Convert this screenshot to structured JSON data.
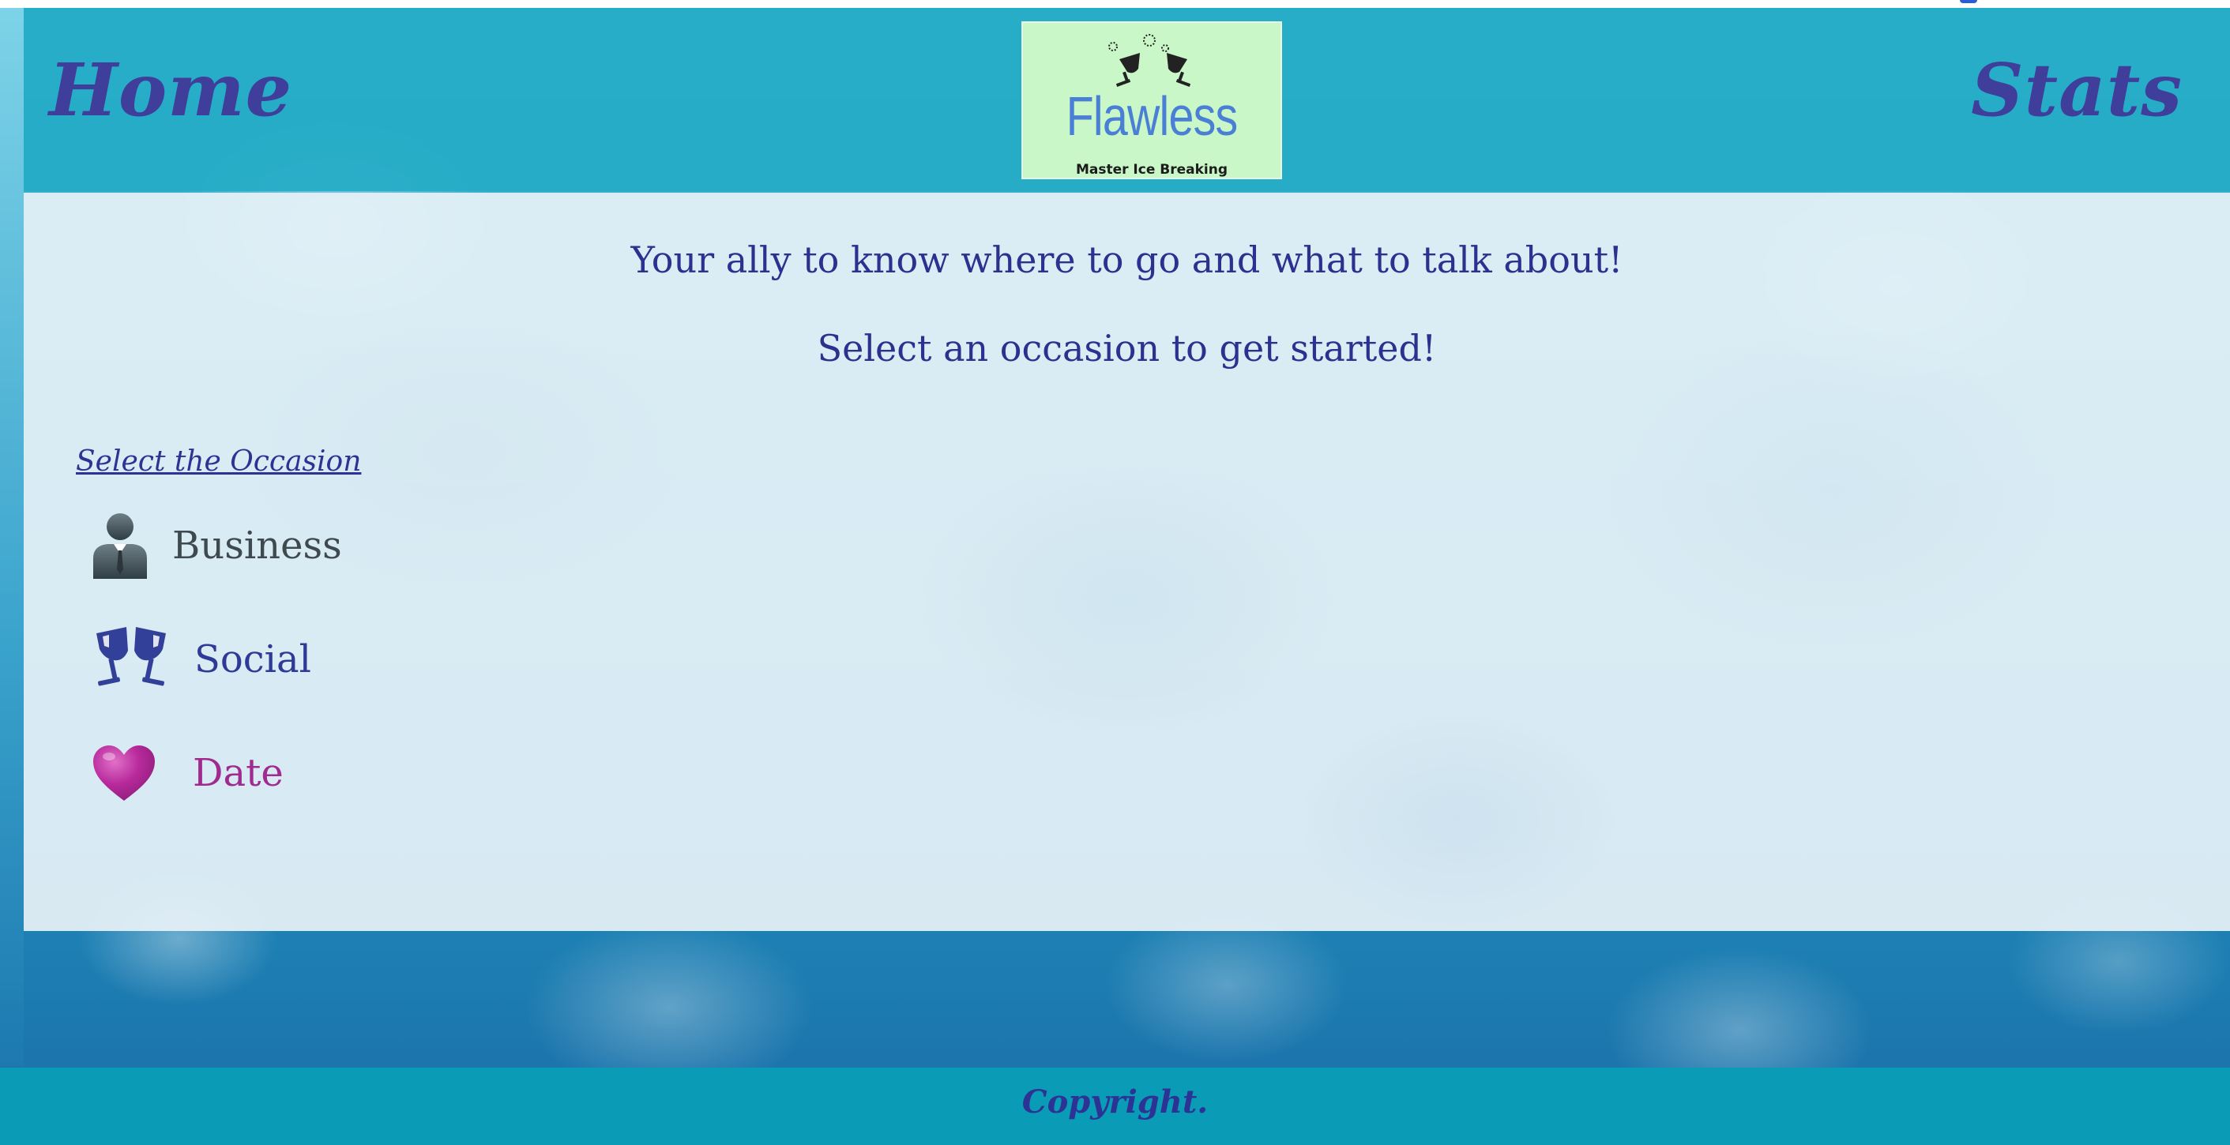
{
  "header": {
    "nav": {
      "home": "Home",
      "stats": "Stats"
    },
    "logo": {
      "title": "Flawless",
      "tagline": "Master Ice Breaking"
    }
  },
  "main": {
    "tagline_1": "Your ally to know where to go and what to talk about!",
    "tagline_2": "Select an occasion to get started!",
    "occasions": {
      "heading": "Select the Occasion",
      "items": [
        {
          "label": "Business",
          "icon": "businessman-icon",
          "color": "#3e4a50"
        },
        {
          "label": "Social",
          "icon": "wine-glasses-icon",
          "color": "#2e3a96"
        },
        {
          "label": "Date",
          "icon": "heart-icon",
          "color": "#a12a8f"
        }
      ]
    }
  },
  "footer": {
    "copyright": "Copyright."
  },
  "colors": {
    "header_bg": "#26acc6",
    "footer_bg": "#0a9bb6",
    "nav_text": "#3f3e9a",
    "heading_text": "#2b318f",
    "logo_bg": "#c9f7c7",
    "logo_title": "#4a7fd6"
  }
}
